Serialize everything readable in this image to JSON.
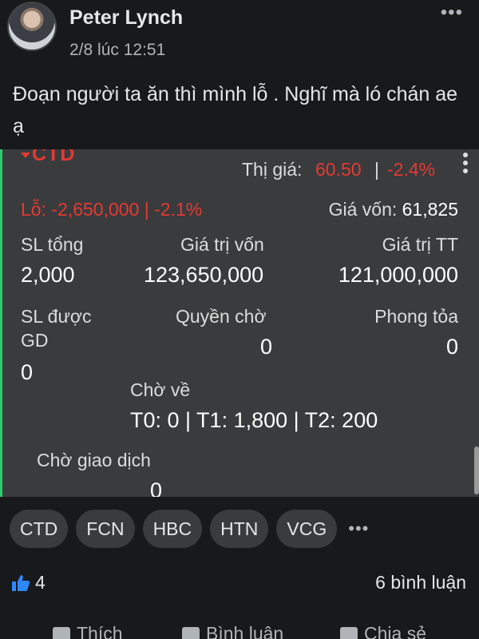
{
  "post": {
    "author": "Peter Lynch",
    "timestamp": "2/8 lúc 12:51",
    "text": "Đoạn người ta ăn thì mình lỗ . Nghĩ mà ló chán ae ạ"
  },
  "card": {
    "symbol": "CTD",
    "market_price_label": "Thị giá:",
    "market_price": "60.50",
    "separator": "|",
    "change": "-2.4%",
    "loss_label": "Lỗ:",
    "loss_value": "-2,650,000 | -2.1%",
    "cost_price_label": "Giá vốn:",
    "cost_price": "61,825",
    "total_qty_label": "SL tổng",
    "total_qty": "2,000",
    "capital_value_label": "Giá trị vốn",
    "capital_value": "123,650,000",
    "market_value_label": "Giá trị TT",
    "market_value": "121,000,000",
    "tradable_label_line1": "SL được",
    "tradable_label_line2": "GD",
    "tradable_value": "0",
    "pending_rights_label": "Quyền chờ",
    "pending_rights_value": "0",
    "blocked_label": "Phong tỏa",
    "blocked_value": "0",
    "pending_arrival_label": "Chờ về",
    "pending_arrival_value": "T0: 0 | T1: 1,800 | T2: 200",
    "pending_trade_label": "Chờ giao dịch",
    "pending_trade_value": "0"
  },
  "tags": [
    "CTD",
    "FCN",
    "HBC",
    "HTN",
    "VCG"
  ],
  "tags_more": "•••",
  "reactions": {
    "count": "4",
    "comments": "6 bình luận"
  },
  "actions": {
    "like": "Thích",
    "comment": "Bình luận",
    "share": "Chia sẻ"
  },
  "header_more": "•••",
  "colors": {
    "accent_green": "#2ecc71",
    "loss_red": "#e53935",
    "background": "#18191a",
    "card": "#3a3b3c",
    "like_blue": "#2d88ff"
  }
}
